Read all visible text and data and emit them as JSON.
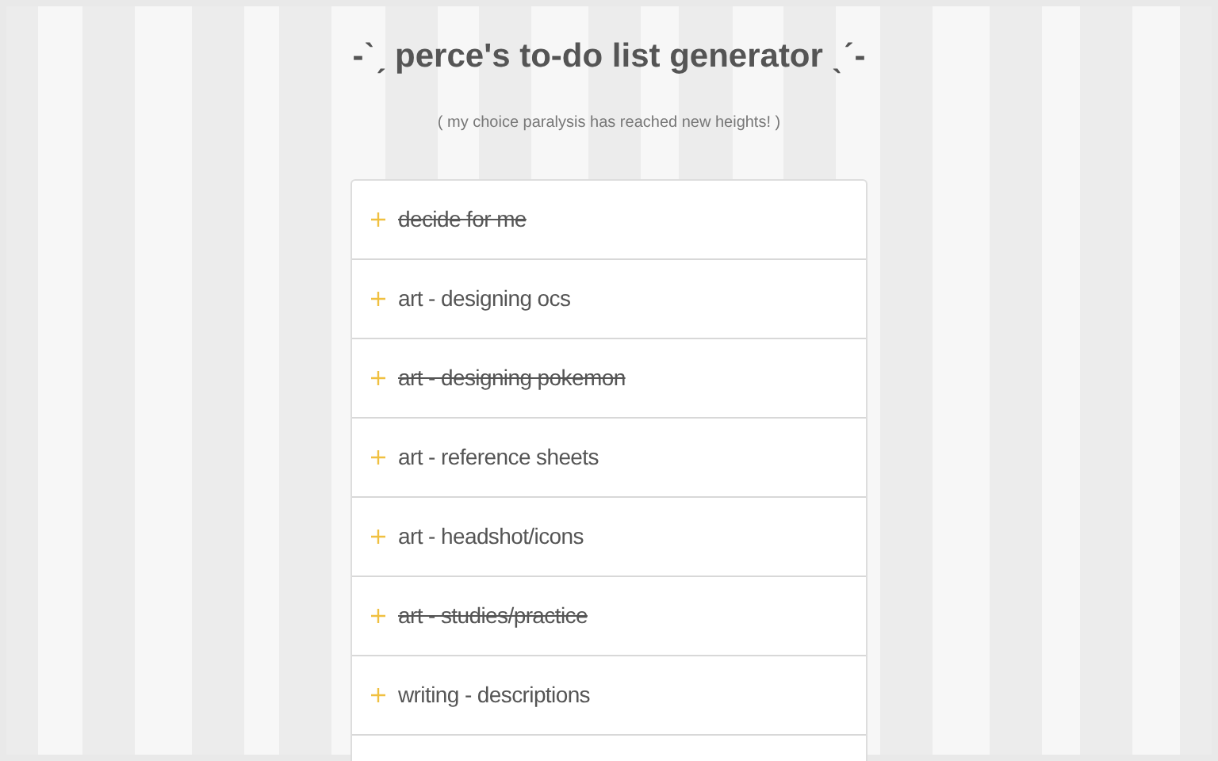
{
  "header": {
    "title": "-ˋˏ perce's to-do list generator ˎˊ-",
    "subtitle": "( my choice paralysis has reached new heights! )"
  },
  "tasks": [
    {
      "label": "decide for me",
      "done": true
    },
    {
      "label": "art - designing ocs",
      "done": false
    },
    {
      "label": "art - designing pokemon",
      "done": true
    },
    {
      "label": "art - reference sheets",
      "done": false
    },
    {
      "label": "art - headshot/icons",
      "done": false
    },
    {
      "label": "art - studies/practice",
      "done": true
    },
    {
      "label": "writing - descriptions",
      "done": false
    }
  ]
}
